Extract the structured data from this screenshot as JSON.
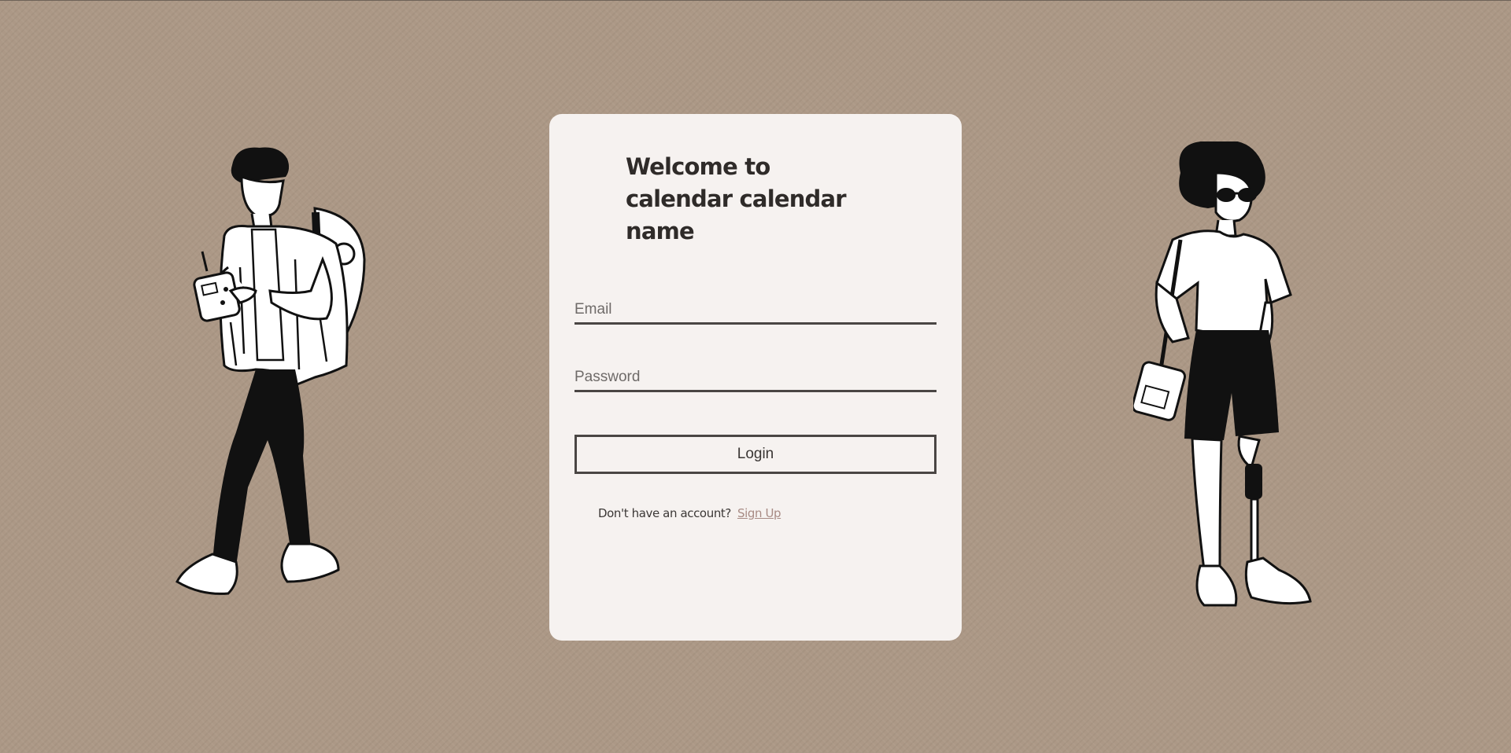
{
  "login": {
    "title": "Welcome to calendar calendar name",
    "email_placeholder": "Email",
    "password_placeholder": "Password",
    "login_label": "Login",
    "signup_prompt": "Don't have an account?",
    "signup_link": "Sign Up"
  },
  "illustrations": {
    "left": "man-walking-with-device-illustration",
    "right": "woman-with-sunglasses-illustration"
  },
  "colors": {
    "background": "#ac9886",
    "card": "#f6f2f0",
    "text": "#2f2b29",
    "link": "#a88b84",
    "border": "#4a4644"
  }
}
